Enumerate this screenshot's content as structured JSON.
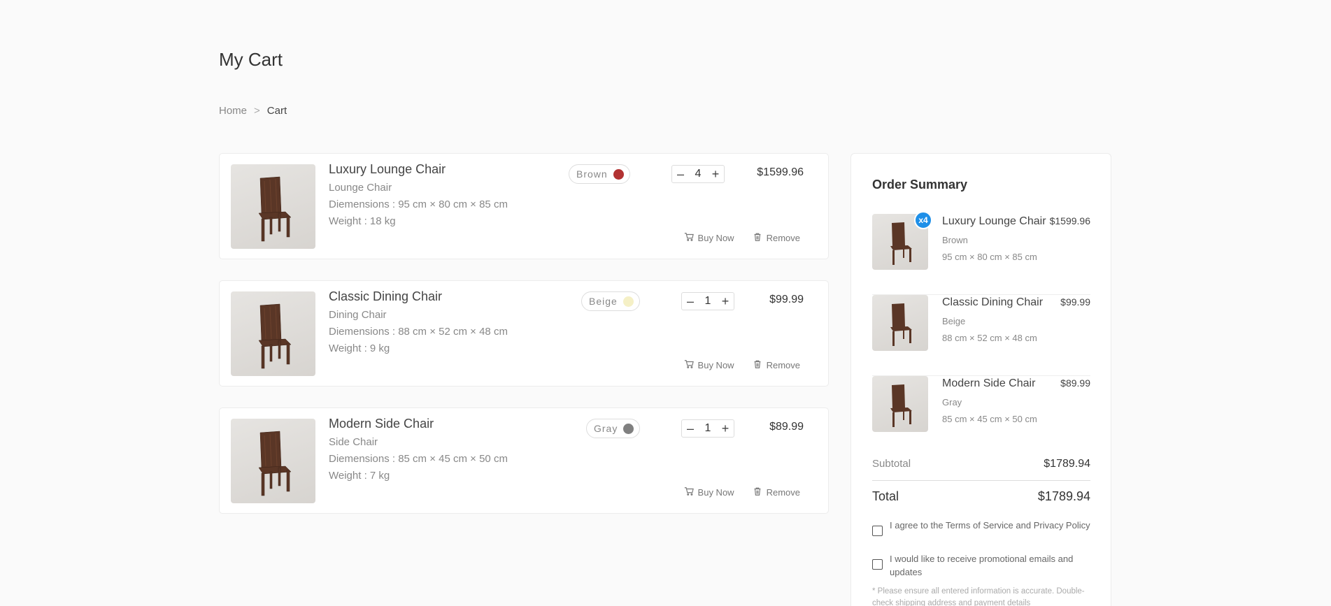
{
  "page": {
    "title": "My Cart"
  },
  "breadcrumb": {
    "home": "Home",
    "separator": ">",
    "current": "Cart"
  },
  "labels": {
    "buy_now": "Buy Now",
    "remove": "Remove",
    "step_minus": "–",
    "step_plus": "+"
  },
  "cart_items": [
    {
      "name": "Luxury Lounge Chair",
      "category": "Lounge Chair",
      "dimensions": "Diemensions : 95 cm × 80 cm × 85 cm",
      "weight": "Weight : 18 kg",
      "color_name": "Brown",
      "color_hex": "#b23232",
      "quantity": "4",
      "price": "$1599.96"
    },
    {
      "name": "Classic Dining Chair",
      "category": "Dining Chair",
      "dimensions": "Diemensions : 88 cm × 52 cm × 48 cm",
      "weight": "Weight : 9 kg",
      "color_name": "Beige",
      "color_hex": "#f5f0c6",
      "quantity": "1",
      "price": "$99.99"
    },
    {
      "name": "Modern Side Chair",
      "category": "Side Chair",
      "dimensions": "Diemensions : 85 cm × 45 cm × 50 cm",
      "weight": "Weight : 7 kg",
      "color_name": "Gray",
      "color_hex": "#808080",
      "quantity": "1",
      "price": "$89.99"
    }
  ],
  "summary": {
    "title": "Order Summary",
    "items": [
      {
        "name": "Luxury Lounge Chair",
        "price": "$1599.96",
        "color": "Brown",
        "dims": "95 cm × 80 cm × 85 cm",
        "badge": "x4"
      },
      {
        "name": "Classic Dining Chair",
        "price": "$99.99",
        "color": "Beige",
        "dims": "88 cm × 52 cm × 48 cm"
      },
      {
        "name": "Modern Side Chair",
        "price": "$89.99",
        "color": "Gray",
        "dims": "85 cm × 45 cm × 50 cm"
      }
    ],
    "subtotal_label": "Subtotal",
    "subtotal_value": "$1789.94",
    "total_label": "Total",
    "total_value": "$1789.94",
    "terms_label": "I agree to the Terms of Service and Privacy Policy",
    "promo_label": "I would like to receive promotional emails and updates",
    "note": "* Please ensure all entered information is accurate. Double-check shipping address and payment details"
  },
  "colors": {
    "badge": "#1e8fe8",
    "background": "#fafafa"
  }
}
